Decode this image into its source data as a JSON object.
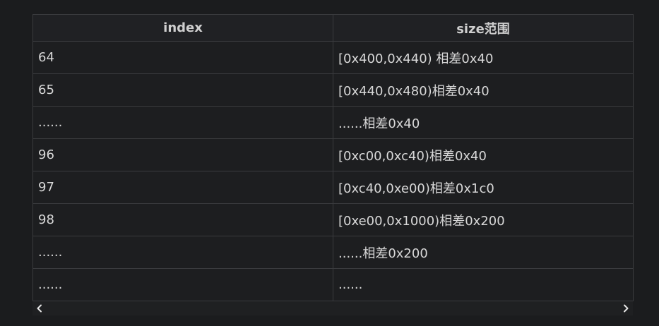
{
  "table": {
    "headers": [
      "index",
      "size范围"
    ],
    "rows": [
      [
        "64",
        "[0x400,0x440) 相差0x40"
      ],
      [
        "65",
        "[0x440,0x480)相差0x40"
      ],
      [
        "......",
        "......相差0x40"
      ],
      [
        "96",
        "[0xc00,0xc40)相差0x40"
      ],
      [
        "97",
        "[0xc40,0xe00)相差0x1c0"
      ],
      [
        "98",
        "[0xe00,0x1000)相差0x200"
      ],
      [
        "......",
        "......相差0x200"
      ],
      [
        "......",
        "......"
      ]
    ]
  },
  "scrollbar": {
    "left_icon": "chevron-left-icon",
    "right_icon": "chevron-right-icon"
  },
  "colors": {
    "background": "#1b1c1e",
    "border": "#3a3b3e",
    "text": "#d8d8d8"
  }
}
